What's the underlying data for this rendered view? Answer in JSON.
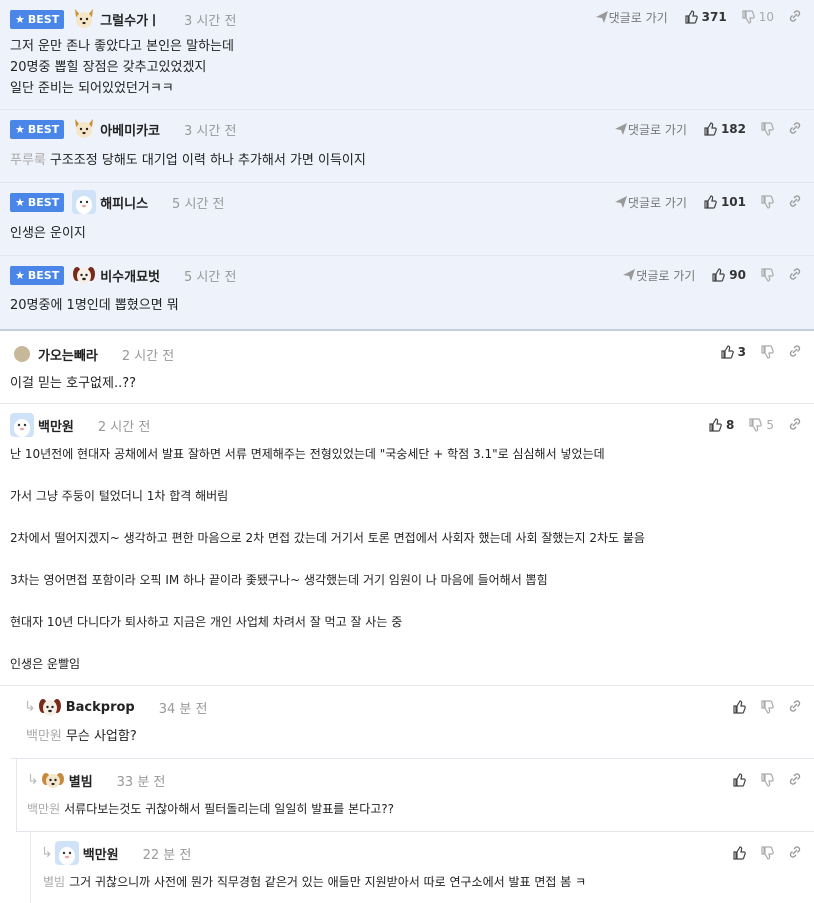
{
  "best_comments": [
    {
      "badge": "BEST",
      "nick": "그럴수가ㅣ",
      "time": "3 시간 전",
      "reply_label": "댓글로 가기",
      "up": "371",
      "down": "10",
      "lines": [
        "그저 운만 존나 좋았다고 본인은 말하는데",
        "20명중 뽑힐 장점은 갖추고있었겠지",
        "일단 준비는 되어있었던거ㅋㅋ"
      ]
    },
    {
      "badge": "BEST",
      "nick": "아베미카코",
      "time": "3 시간 전",
      "reply_label": "댓글로 가기",
      "up": "182",
      "down": "",
      "mention": "푸루룩",
      "lines": [
        "구조조정 당해도 대기업 이력 하나 추가해서 가면 이득이지"
      ]
    },
    {
      "badge": "BEST",
      "nick": "해피니스",
      "time": "5 시간 전",
      "reply_label": "댓글로 가기",
      "up": "101",
      "down": "",
      "lines": [
        "인생은 운이지"
      ]
    },
    {
      "badge": "BEST",
      "nick": "비수개묘벗",
      "time": "5 시간 전",
      "reply_label": "댓글로 가기",
      "up": "90",
      "down": "",
      "lines": [
        "20명중에 1명인데 뽑혔으면 뭐"
      ]
    }
  ],
  "comments": [
    {
      "nick": "가오는빼라",
      "time": "2 시간 전",
      "up": "3",
      "down": "",
      "lines": [
        "이걸 믿는 호구없제..??"
      ]
    },
    {
      "nick": "백만원",
      "time": "2 시간 전",
      "up": "8",
      "down": "5",
      "paras": [
        "난 10년전에 현대자 공채에서 발표 잘하면 서류 면제해주는 전형있었는데 \"국숭세단 + 학점 3.1\"로 심심해서 넣었는데",
        "가서 그냥 주둥이 털었더니 1차 합격 해버림",
        "2차에서 떨어지겠지~ 생각하고 편한 마음으로 2차 면접 갔는데 거기서 토론 면접에서 사회자 했는데 사회 잘했는지 2차도 붙음",
        "3차는 영어면접 포함이라 오픽 IM 하나 끝이라 좇됐구나~ 생각했는데 거기 임원이 나 마음에 들어해서 뽑힘",
        "현대자 10년 다니다가 퇴사하고 지금은 개인 사업체 차려서 잘 먹고 잘 사는 중",
        "인생은 운빨임"
      ]
    }
  ],
  "replies": [
    {
      "nick": "Backprop",
      "time": "34 분 전",
      "mention": "백만원",
      "text": "무슨 사업함?"
    },
    {
      "nick": "별빔",
      "time": "33 분 전",
      "mention": "백만원",
      "text": "서류다보는것도 귀찮아해서 필터돌리는데 일일히 발표를 본다고??"
    },
    {
      "nick": "백만원",
      "time": "22 분 전",
      "mention": "별빔",
      "text": "그거 귀찮으니까 사전에 뭔가 직무경험 같은거 있는 애들만 지원받아서 따로 연구소에서 발표 면접 봄 ㅋ"
    }
  ],
  "colors": {
    "best_bg": "#eef2fb",
    "badge": "#4a86e8"
  }
}
